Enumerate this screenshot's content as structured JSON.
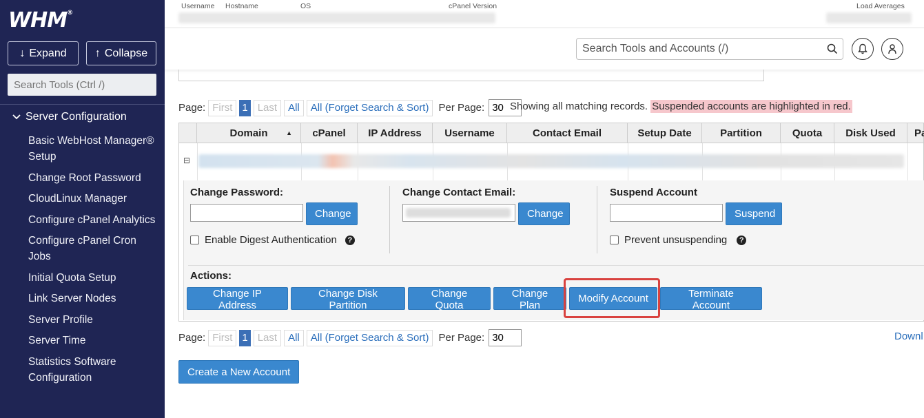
{
  "sidebar": {
    "logo": "WHM",
    "logo_mark": "®",
    "expand_label": "Expand",
    "collapse_label": "Collapse",
    "search_placeholder": "Search Tools (Ctrl /)",
    "section_label": "Server Configuration",
    "items": [
      {
        "label": "Basic WebHost Manager® Setup"
      },
      {
        "label": "Change Root Password"
      },
      {
        "label": "CloudLinux Manager"
      },
      {
        "label": "Configure cPanel Analytics"
      },
      {
        "label": "Configure cPanel Cron Jobs"
      },
      {
        "label": "Initial Quota Setup"
      },
      {
        "label": "Link Server Nodes"
      },
      {
        "label": "Server Profile"
      },
      {
        "label": "Server Time"
      },
      {
        "label": "Statistics Software Configuration"
      }
    ]
  },
  "topinfo": {
    "username": "Username",
    "hostname": "Hostname",
    "os": "OS",
    "cpanel_version": "cPanel Version",
    "load_averages": "Load Averages"
  },
  "header": {
    "search_placeholder": "Search Tools and Accounts (/)"
  },
  "pager": {
    "page_label": "Page:",
    "first": "First",
    "current": "1",
    "last": "Last",
    "all": "All",
    "forget": "All (Forget Search & Sort)",
    "per_page_label": "Per Page:",
    "per_page_value": "30"
  },
  "showing": {
    "text": "Showing all matching records.",
    "highlight": "Suspended accounts are highlighted in red."
  },
  "table": {
    "columns": [
      "Domain",
      "cPanel",
      "IP Address",
      "Username",
      "Contact Email",
      "Setup Date",
      "Partition",
      "Quota",
      "Disk Used",
      "Pa"
    ],
    "sort_indicator": "▲",
    "collapse_toggle": "⊟"
  },
  "panel": {
    "change_password_label": "Change Password:",
    "change_button": "Change",
    "digest_label": "Enable Digest Authentication",
    "change_email_label": "Change Contact Email:",
    "suspend_label": "Suspend Account",
    "suspend_button": "Suspend",
    "prevent_label": "Prevent unsuspending",
    "actions_label": "Actions:",
    "actions": {
      "change_ip": "Change IP Address",
      "change_partition": "Change Disk Partition",
      "change_quota": "Change Quota",
      "change_plan": "Change Plan",
      "modify": "Modify Account",
      "terminate": "Terminate Account"
    }
  },
  "footer": {
    "download": "Downl",
    "create": "Create a New Account"
  },
  "colors": {
    "sidebar_bg": "#1f2554",
    "button_blue": "#3a88cf",
    "highlight_red": "#d9423f",
    "suspended_bg": "#f6c7cc"
  }
}
